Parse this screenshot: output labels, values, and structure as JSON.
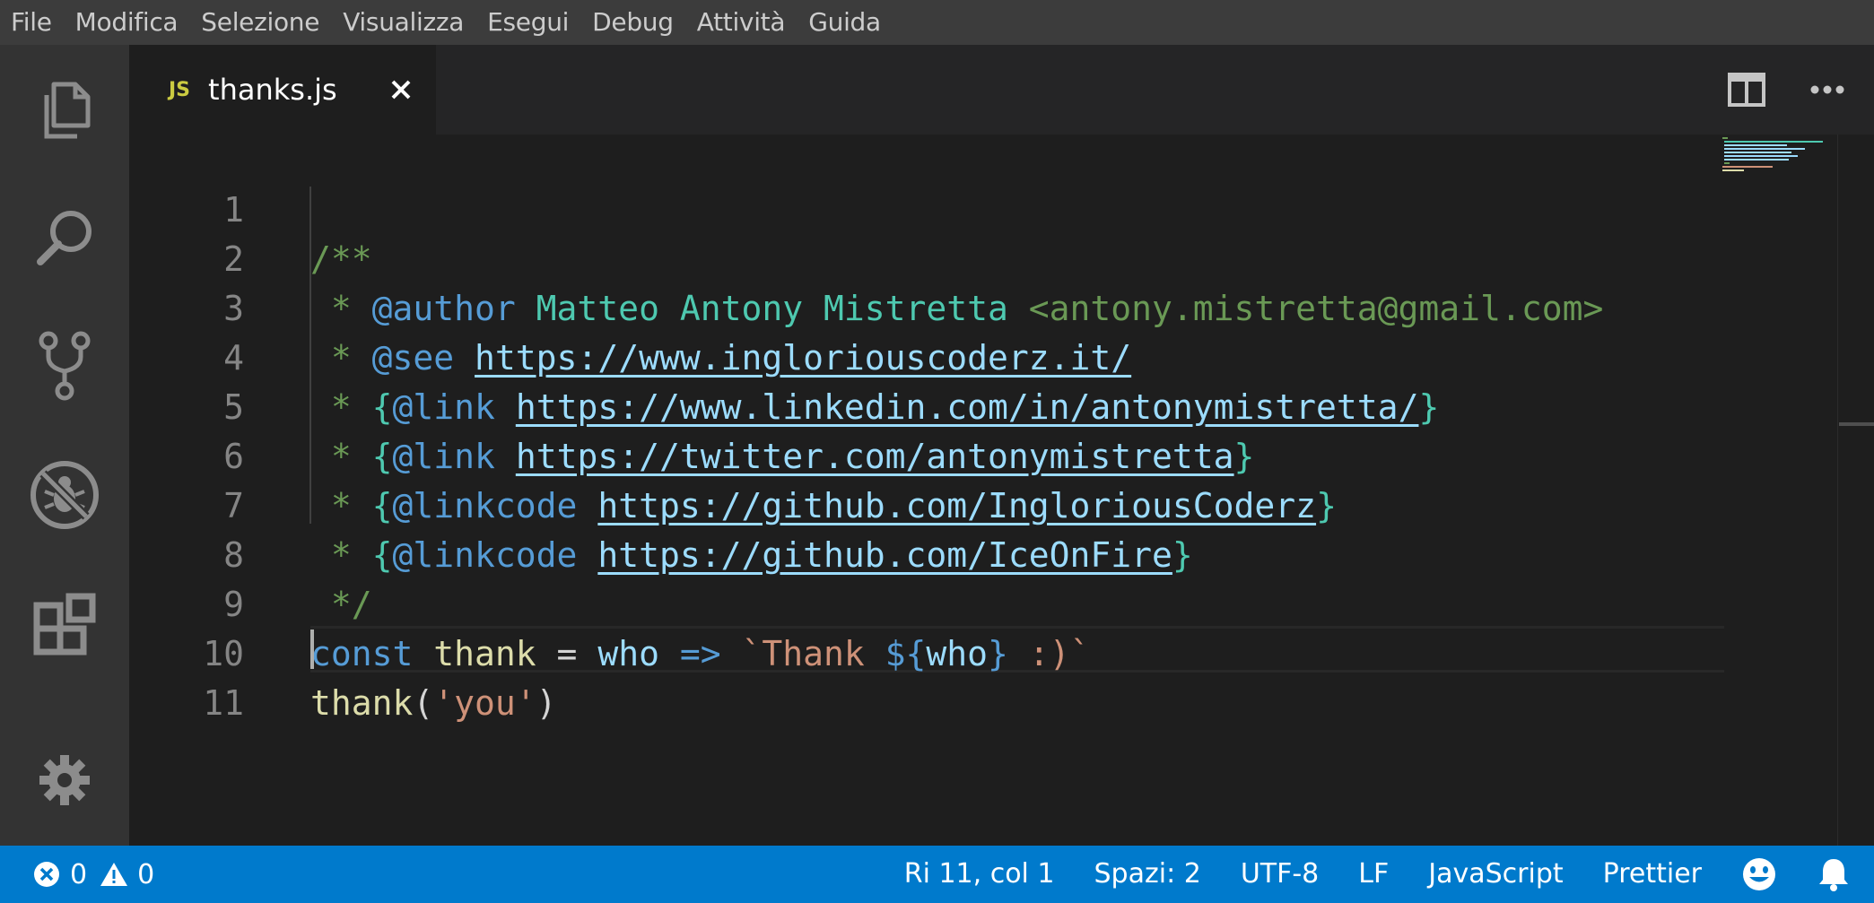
{
  "menu": [
    "File",
    "Modifica",
    "Selezione",
    "Visualizza",
    "Esegui",
    "Debug",
    "Attività",
    "Guida"
  ],
  "activity_bar": {
    "items": [
      "explorer-icon",
      "search-icon",
      "source-control-icon",
      "debug-icon",
      "extensions-icon"
    ],
    "bottom": "gear-icon"
  },
  "tab": {
    "icon_label": "JS",
    "filename": "thanks.js",
    "close_icon": "close-icon"
  },
  "editor_actions": [
    "split-editor-icon",
    "more-actions-icon"
  ],
  "editor": {
    "line_numbers": [
      "1",
      "2",
      "3",
      "4",
      "5",
      "6",
      "7",
      "8",
      "9",
      "10",
      "11"
    ],
    "line1": "/**",
    "line2": {
      "star": " * ",
      "tag": "@author",
      "name": " Matteo Antony Mistretta ",
      "email": "<antony.mistretta@gmail.com>"
    },
    "line3": {
      "star": " * ",
      "tag": "@see",
      "space": " ",
      "url": "https://www.ingloriouscoderz.it/"
    },
    "line4": {
      "star": " * ",
      "open": "{",
      "tag": "@link",
      "space": " ",
      "url": "https://www.linkedin.com/in/antonymistretta/",
      "close": "}"
    },
    "line5": {
      "star": " * ",
      "open": "{",
      "tag": "@link",
      "space": " ",
      "url": "https://twitter.com/antonymistretta",
      "close": "}"
    },
    "line6": {
      "star": " * ",
      "open": "{",
      "tag": "@linkcode",
      "space": " ",
      "url": "https://github.com/IngloriousCoderz",
      "close": "}"
    },
    "line7": {
      "star": " * ",
      "open": "{",
      "tag": "@linkcode",
      "space": " ",
      "url": "https://github.com/IceOnFire",
      "close": "}"
    },
    "line8": " */",
    "line9": {
      "kw": "const",
      "fn": " thank",
      "eq": " = ",
      "param": "who",
      "arrow": " => ",
      "tick": "`",
      "str": "Thank ",
      "dollar": "${",
      "var": "who",
      "rbrace": "}",
      "str2": " :)",
      "tick2": "`"
    },
    "line10": {
      "fn": "thank",
      "lparen": "(",
      "str": "'you'",
      "rparen": ")"
    },
    "line11": ""
  },
  "status": {
    "errors": "0",
    "warnings": "0",
    "position": "Ri 11, col 1",
    "spaces": "Spazi: 2",
    "encoding": "UTF-8",
    "eol": "LF",
    "language": "JavaScript",
    "formatter": "Prettier"
  },
  "colors": {
    "status_bar": "#007acc",
    "activity_bar": "#333333",
    "editor_bg": "#1e1e1e",
    "comment": "#6a9955",
    "keyword": "#569cd6",
    "string": "#ce9178",
    "function": "#dcdcaa"
  }
}
